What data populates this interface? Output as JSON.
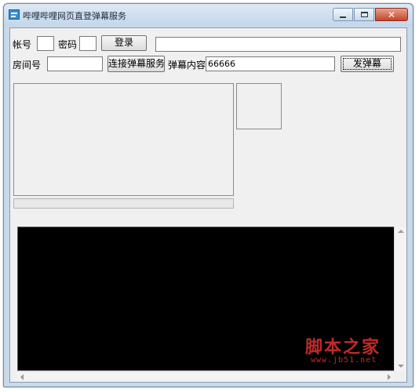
{
  "window": {
    "title": "哔哩哔哩网页直登弹幕服务",
    "app_icon": "app-icon",
    "controls": {
      "minimize_icon": "minimize-icon",
      "maximize_icon": "maximize-icon",
      "close_glyph": "✕"
    }
  },
  "login": {
    "account_label": "帐号",
    "account_value": "",
    "password_label": "密码",
    "password_value": "",
    "login_button": "登录",
    "status_value": ""
  },
  "room": {
    "room_label": "房间号",
    "room_value": "",
    "connect_button": "连接弹幕服务",
    "danmaku_label": "弹幕内容",
    "danmaku_value": "66666",
    "send_button": "发弹幕"
  },
  "progress": {
    "value": 0
  },
  "watermark": {
    "main": "脚本之家",
    "sub": "www.jb51.net"
  }
}
